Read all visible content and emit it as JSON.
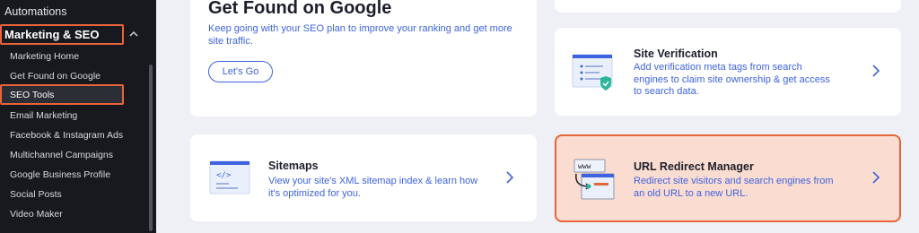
{
  "sidebar": {
    "automations": "Automations",
    "marketing_seo": "Marketing & SEO",
    "items": [
      {
        "label": "Marketing Home"
      },
      {
        "label": "Get Found on Google"
      },
      {
        "label": "SEO Tools"
      },
      {
        "label": "Email Marketing"
      },
      {
        "label": "Facebook & Instagram Ads"
      },
      {
        "label": "Multichannel Campaigns"
      },
      {
        "label": "Google Business Profile"
      },
      {
        "label": "Social Posts"
      },
      {
        "label": "Video Maker"
      }
    ]
  },
  "get_found": {
    "title": "Get Found on Google",
    "description": "Keep going with your SEO plan to improve your ranking and get more site traffic.",
    "button": "Let's Go"
  },
  "site_verification": {
    "title": "Site Verification",
    "description": "Add verification meta tags from search engines to claim site ownership & get access to search data."
  },
  "sitemaps": {
    "title": "Sitemaps",
    "description": "View your site's XML sitemap index & learn how it's optimized for you.",
    "icon_text": "</>"
  },
  "url_redirect": {
    "title": "URL Redirect Manager",
    "description": "Redirect site visitors and search engines from an old URL to a new URL.",
    "icon_text": "www"
  },
  "colors": {
    "sidebar_bg": "#17191e",
    "highlight": "#e8643a",
    "link_blue": "#3d63e0",
    "highlight_card_bg": "#fbdcd1"
  }
}
